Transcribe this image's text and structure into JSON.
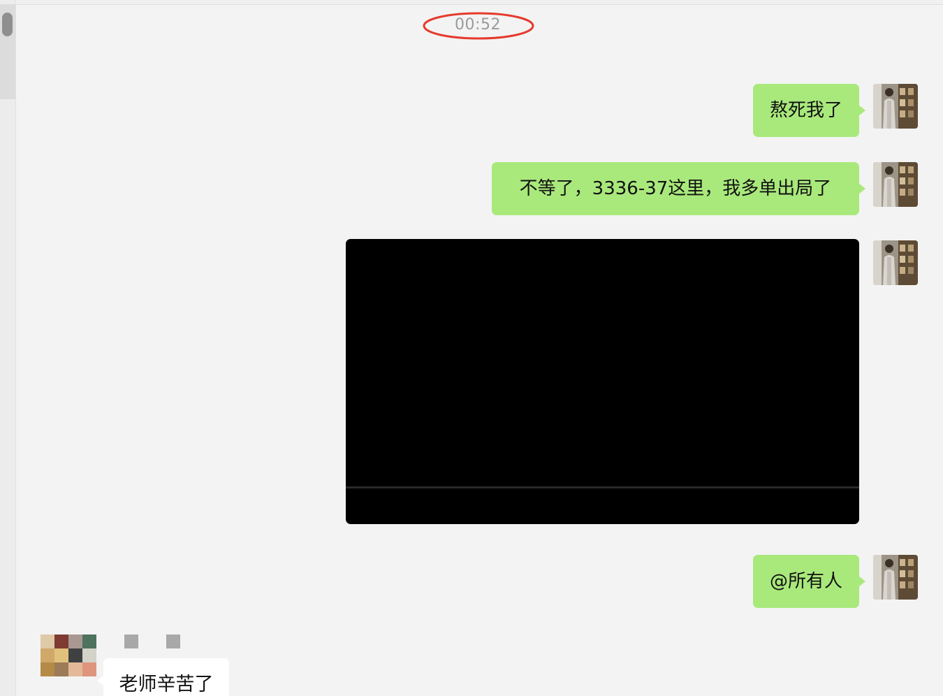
{
  "chat": {
    "timestamp": "00:52",
    "messages": [
      {
        "sender": "me",
        "type": "text",
        "text": "熬死我了"
      },
      {
        "sender": "me",
        "type": "text",
        "text": "不等了，3336-37这里，我多单出局了"
      },
      {
        "sender": "me",
        "type": "video"
      },
      {
        "sender": "me",
        "type": "text",
        "text": "@所有人"
      },
      {
        "sender": "other",
        "type": "text",
        "text": "老师辛苦了"
      }
    ]
  },
  "colors": {
    "outgoing_bubble": "#a9e97c",
    "incoming_bubble": "#ffffff",
    "background": "#f3f3f3",
    "highlight_ring": "#e53a2c"
  },
  "icons": {
    "my_avatar": "user-avatar-photo",
    "other_avatar": "pixelated-avatar"
  }
}
